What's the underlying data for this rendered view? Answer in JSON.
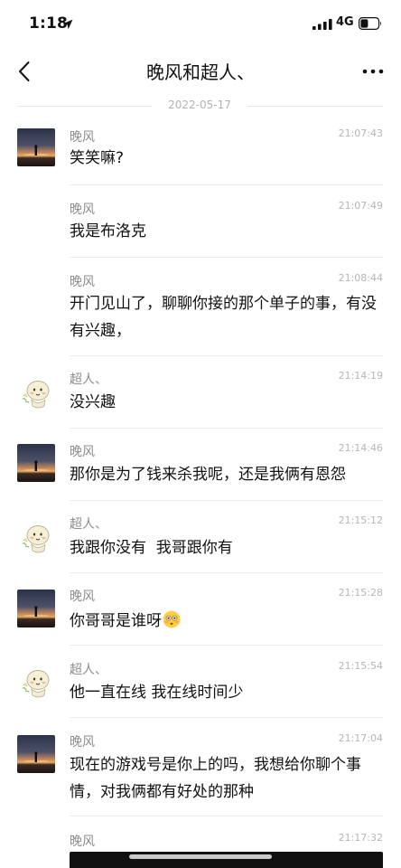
{
  "status_bar": {
    "time": "1:18",
    "network": "4G"
  },
  "header": {
    "title": "晚风和超人、",
    "back_icon": "chevron-left-icon",
    "more_icon": "more-horizontal-icon"
  },
  "date_separator": "2022-05-17",
  "messages": [
    {
      "sender": "晚风",
      "time": "21:07:43",
      "text": "笑笑嘛?"
    },
    {
      "sender": "晚风",
      "time": "21:07:49",
      "text": "我是布洛克"
    },
    {
      "sender": "晚风",
      "time": "21:08:44",
      "text": "开门见山了，聊聊你接的那个单子的事，有没有兴趣，"
    },
    {
      "sender": "超人、",
      "time": "21:14:19",
      "text": "没兴趣"
    },
    {
      "sender": "晚风",
      "time": "21:14:46",
      "text": "那你是为了钱来杀我呢，还是我俩有恩怨"
    },
    {
      "sender": "超人、",
      "time": "21:15:12",
      "text": "我跟你没有  我哥跟你有"
    },
    {
      "sender": "晚风",
      "time": "21:15:28",
      "text": "你哥哥是谁呀"
    },
    {
      "sender": "超人、",
      "time": "21:15:54",
      "text": "他一直在线 我在线时间少"
    },
    {
      "sender": "晚风",
      "time": "21:17:04",
      "text": "现在的游戏号是你上的吗，我想给你聊个事情，对我俩都有好处的那种"
    },
    {
      "sender": "晚风",
      "time": "21:17:32"
    }
  ],
  "colors": {
    "text_primary": "#111111",
    "text_secondary": "#8c8c8c",
    "timestamp": "#b5b5b5",
    "divider": "#ececec"
  }
}
